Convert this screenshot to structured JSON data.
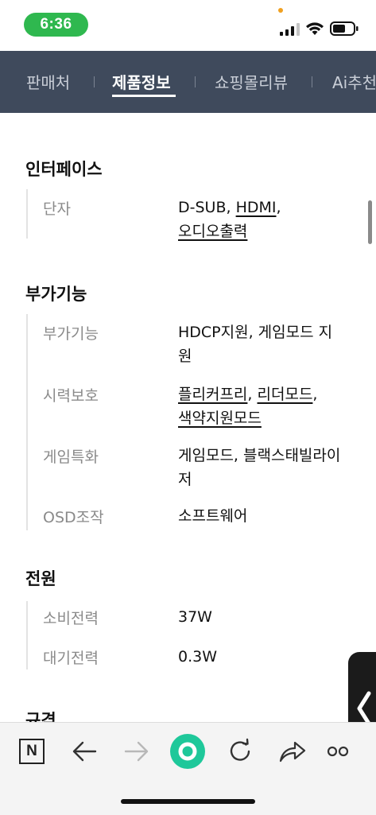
{
  "status": {
    "time": "6:36"
  },
  "tabs": [
    {
      "label": "판매처"
    },
    {
      "label": "제품정보",
      "active": true
    },
    {
      "label": "쇼핑몰리뷰"
    },
    {
      "label": "Ai추천"
    }
  ],
  "sections": {
    "interface": {
      "title": "인터페이스",
      "rows": [
        {
          "label": "단자",
          "value_parts": [
            "D-SUB",
            ", ",
            "HDMI",
            ",",
            "오디오출력"
          ]
        }
      ]
    },
    "extra": {
      "title": "부가기능",
      "rows": [
        {
          "label": "부가기능",
          "value": "HDCP지원, 게임모드 지원"
        },
        {
          "label": "시력보호",
          "value_parts": [
            "플리커프리",
            ", ",
            "리더모드",
            ",",
            "색약지원모드"
          ]
        },
        {
          "label": "게임특화",
          "value": "게임모드, 블랙스태빌라이저"
        },
        {
          "label": "OSD조작",
          "value": "소프트웨어"
        }
      ]
    },
    "power": {
      "title": "전원",
      "rows": [
        {
          "label": "소비전력",
          "value": "37W"
        },
        {
          "label": "대기전력",
          "value": "0.3W"
        }
      ]
    },
    "spec": {
      "title": "규격"
    }
  },
  "bottom_bar": {
    "n_label": "N",
    "icons": [
      "n-logo-icon",
      "back-arrow-icon",
      "forward-arrow-icon",
      "green-home-dot-icon",
      "refresh-icon",
      "share-icon",
      "more-icon"
    ]
  },
  "colors": {
    "tab_bg": "#3f4a5c",
    "time_pill": "#2fb84f",
    "green_button": "#1ec89a"
  }
}
